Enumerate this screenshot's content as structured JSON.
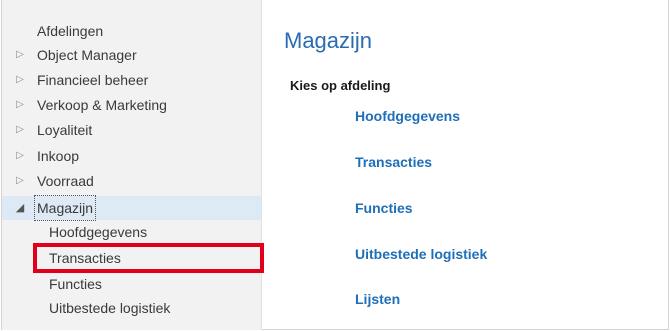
{
  "sidebar": {
    "items": [
      {
        "label": "Afdelingen",
        "arrow": ""
      },
      {
        "label": "Object Manager",
        "arrow": "▷"
      },
      {
        "label": "Financieel beheer",
        "arrow": "▷"
      },
      {
        "label": "Verkoop & Marketing",
        "arrow": "▷"
      },
      {
        "label": "Loyaliteit",
        "arrow": "▷"
      },
      {
        "label": "Inkoop",
        "arrow": "▷"
      },
      {
        "label": "Voorraad",
        "arrow": "▷"
      },
      {
        "label": "Magazijn",
        "arrow": "◢"
      }
    ],
    "children": [
      {
        "label": "Hoofdgegevens"
      },
      {
        "label": "Transacties"
      },
      {
        "label": "Functies"
      },
      {
        "label": "Uitbestede logistiek"
      }
    ]
  },
  "main": {
    "title": "Magazijn",
    "section_heading": "Kies op afdeling",
    "links": [
      {
        "label": "Hoofdgegevens"
      },
      {
        "label": "Transacties"
      },
      {
        "label": "Functies"
      },
      {
        "label": "Uitbestede logistiek"
      },
      {
        "label": "Lijsten"
      }
    ]
  },
  "colors": {
    "accent": "#1f6fb8",
    "title": "#2b6cb0",
    "selected_bg": "#dde9f5",
    "highlight_border": "#e0001b"
  }
}
